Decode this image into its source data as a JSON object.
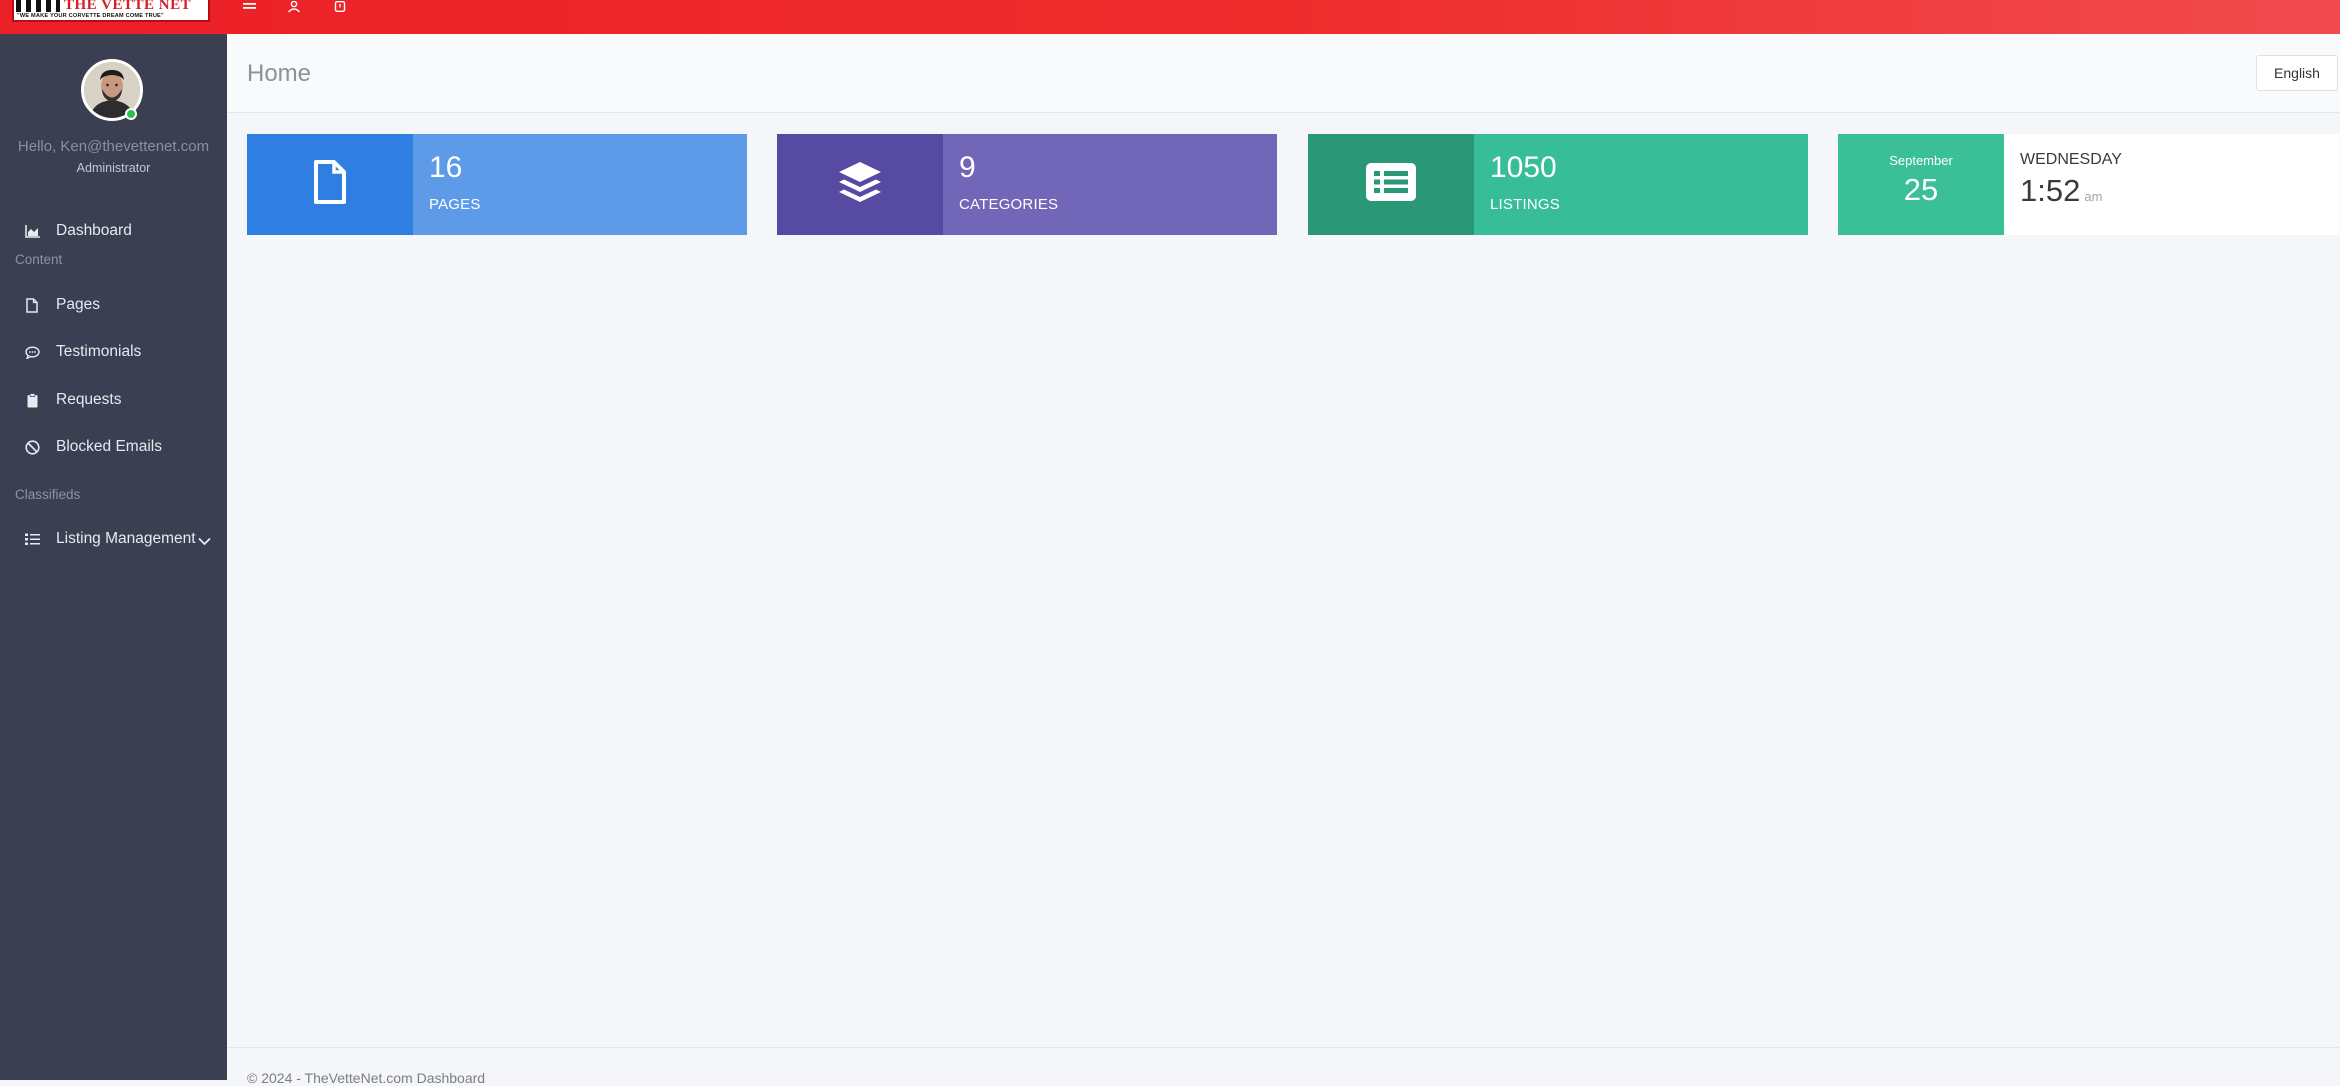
{
  "topbar": {
    "logo_title": "THE VETTE NET",
    "logo_tagline": "\"WE MAKE YOUR CORVETTE DREAM COME TRUE\"",
    "icons": [
      "menu-icon",
      "user-icon",
      "power-icon"
    ]
  },
  "sidebar": {
    "hello": "Hello, Ken@thevettenet.com",
    "role": "Administrator",
    "items": [
      {
        "label": "Dashboard",
        "icon": "chart-area-icon"
      },
      {
        "label": "Pages",
        "icon": "file-icon"
      },
      {
        "label": "Testimonials",
        "icon": "comment-icon"
      },
      {
        "label": "Requests",
        "icon": "clipboard-icon"
      },
      {
        "label": "Blocked Emails",
        "icon": "ban-icon"
      },
      {
        "label": "Listing Management",
        "icon": "tasks-icon"
      }
    ],
    "sections": {
      "content": "Content",
      "classifieds": "Classifieds"
    }
  },
  "header": {
    "title": "Home",
    "language": "English"
  },
  "stats": [
    {
      "value": "16",
      "label": "PAGES",
      "icon": "file-icon",
      "color_dark": "#2f7fe3",
      "color_light": "#5d9ae8"
    },
    {
      "value": "9",
      "label": "CATEGORIES",
      "icon": "layers-icon",
      "color_dark": "#564aa3",
      "color_light": "#7266b8"
    },
    {
      "value": "1050",
      "label": "LISTINGS",
      "icon": "list-alt-icon",
      "color_dark": "#2a9877",
      "color_light": "#37bd98"
    }
  ],
  "date_widget": {
    "month": "September",
    "day": "25",
    "weekday": "WEDNESDAY",
    "time": "1:52",
    "ampm": "am"
  },
  "footer": {
    "text": "© 2024 - TheVetteNet.com Dashboard"
  }
}
